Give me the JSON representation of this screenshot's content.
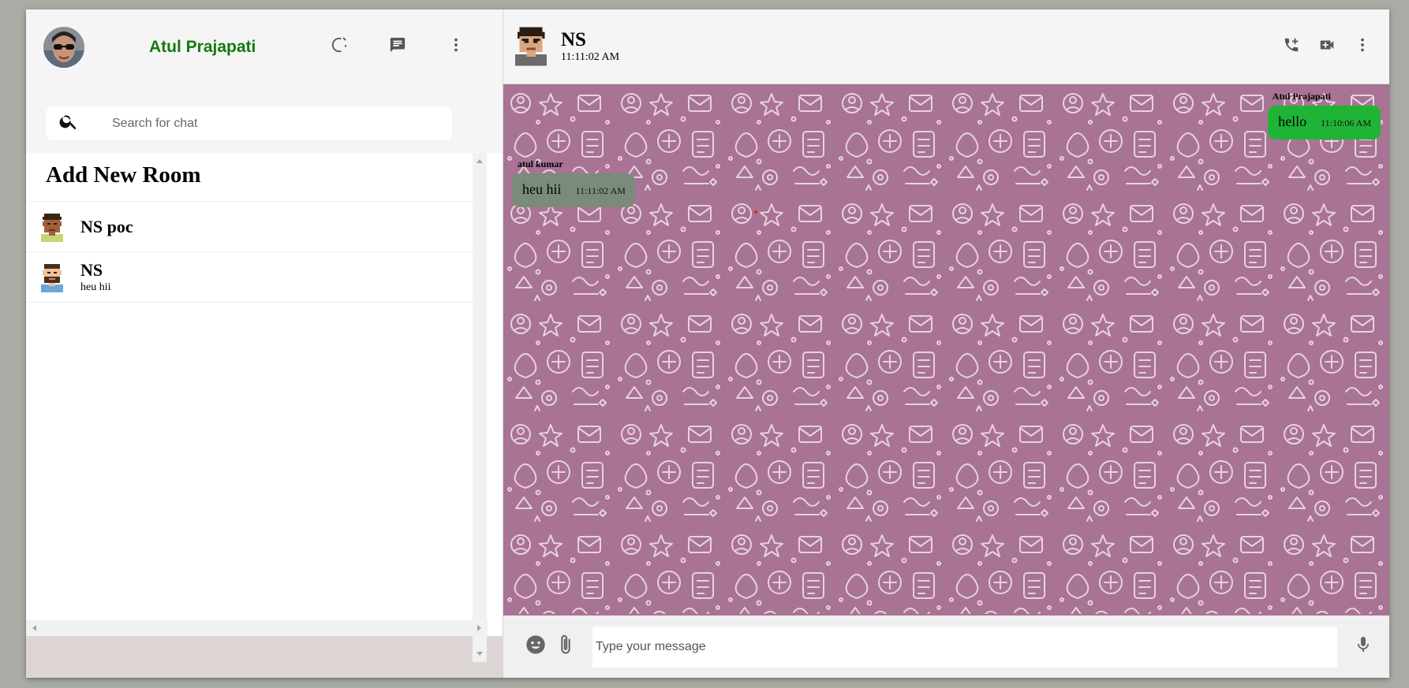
{
  "sidebar": {
    "user_name": "Atul Prajapati",
    "search_placeholder": "Search for chat",
    "add_room_label": "Add New Room",
    "chats": [
      {
        "name": "NS poc",
        "last_message": ""
      },
      {
        "name": "NS",
        "last_message": "heu hii"
      }
    ],
    "icons": [
      "status-icon",
      "new-chat-icon",
      "more-vert-icon",
      "search-icon"
    ]
  },
  "chat": {
    "room_name": "NS",
    "last_seen": "11:11:02 AM",
    "icons": [
      "add-call-icon",
      "video-call-icon",
      "more-vert-icon"
    ],
    "messages": [
      {
        "sender": "Atul Prajapati",
        "text": "hello",
        "time": "11:10:06 AM",
        "direction": "sent"
      },
      {
        "sender": "atul kumar",
        "text": "heu hii",
        "time": "11:11:02 AM",
        "direction": "received"
      }
    ],
    "input_placeholder": "Type your message",
    "footer_icons": [
      "emoji-icon",
      "attach-icon",
      "mic-icon"
    ]
  },
  "colors": {
    "brand_green": "#137a0c",
    "sent_bubble": "#20b437",
    "received_bubble": "#7b8b7b",
    "chat_background": "#a87394",
    "sidebar_footer": "#ddd5d4"
  }
}
